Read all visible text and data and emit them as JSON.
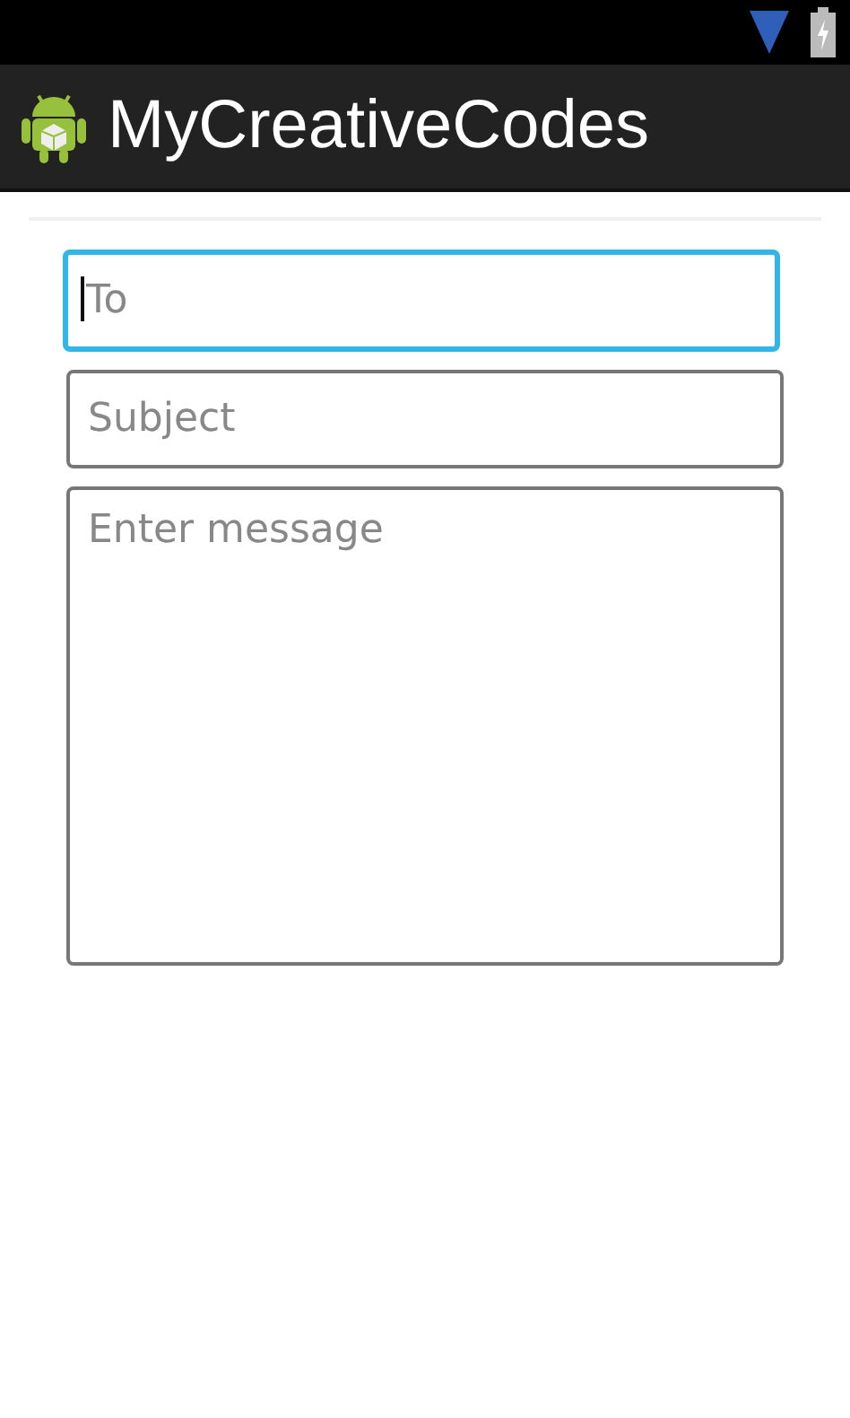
{
  "action_bar": {
    "title": "MyCreativeCodes"
  },
  "fields": [
    {
      "kind": "line",
      "placeholder": "To",
      "focused": true
    },
    {
      "kind": "line",
      "placeholder": "Subject",
      "focused": false
    },
    {
      "kind": "multiline",
      "placeholder": "Enter message",
      "focused": false
    }
  ]
}
